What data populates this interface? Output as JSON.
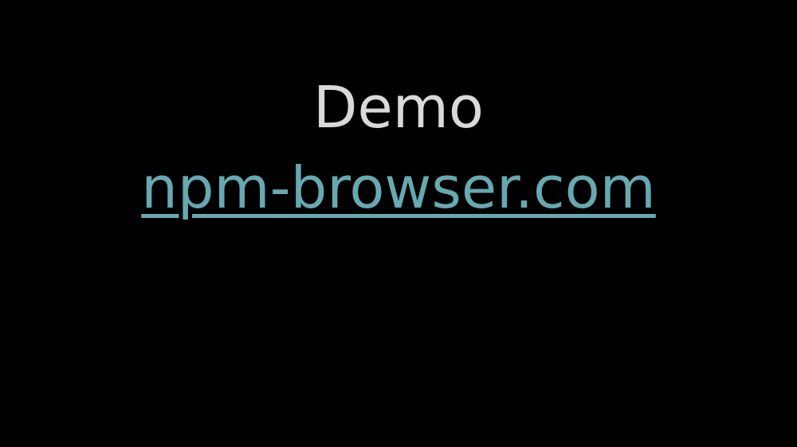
{
  "slide": {
    "heading": "Demo",
    "link_text": "npm-browser.com"
  },
  "colors": {
    "background": "#000000",
    "heading": "#d9d9d9",
    "link": "#66a9b1"
  }
}
